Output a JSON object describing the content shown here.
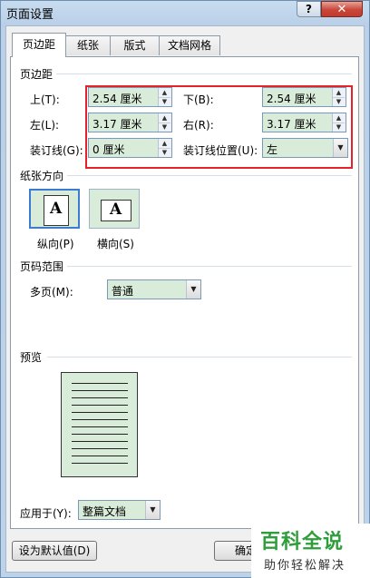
{
  "window": {
    "title": "页面设置",
    "help": "?",
    "close": "✕"
  },
  "tabs": [
    "页边距",
    "纸张",
    "版式",
    "文档网格"
  ],
  "margins": {
    "section": "页边距",
    "top": {
      "label": "上(T):",
      "value": "2.54 厘米"
    },
    "bottom": {
      "label": "下(B):",
      "value": "2.54 厘米"
    },
    "left": {
      "label": "左(L):",
      "value": "3.17 厘米"
    },
    "right": {
      "label": "右(R):",
      "value": "3.17 厘米"
    },
    "gutter": {
      "label": "装订线(G):",
      "value": "0 厘米"
    },
    "gutter_pos": {
      "label": "装订线位置(U):",
      "value": "左"
    }
  },
  "orientation": {
    "section": "纸张方向",
    "portrait": "纵向(P)",
    "landscape": "横向(S)",
    "glyph": "A"
  },
  "pages": {
    "section": "页码范围",
    "label": "多页(M):",
    "value": "普通"
  },
  "preview": {
    "section": "预览"
  },
  "apply": {
    "label": "应用于(Y):",
    "value": "整篇文档"
  },
  "buttons": {
    "default": "设为默认值(D)",
    "ok": "确定"
  },
  "watermark": {
    "title": "百科全说",
    "subtitle": "助你轻松解决"
  },
  "colors": {
    "field_bg": "#d9ecd9",
    "highlight": "#e8202a"
  }
}
